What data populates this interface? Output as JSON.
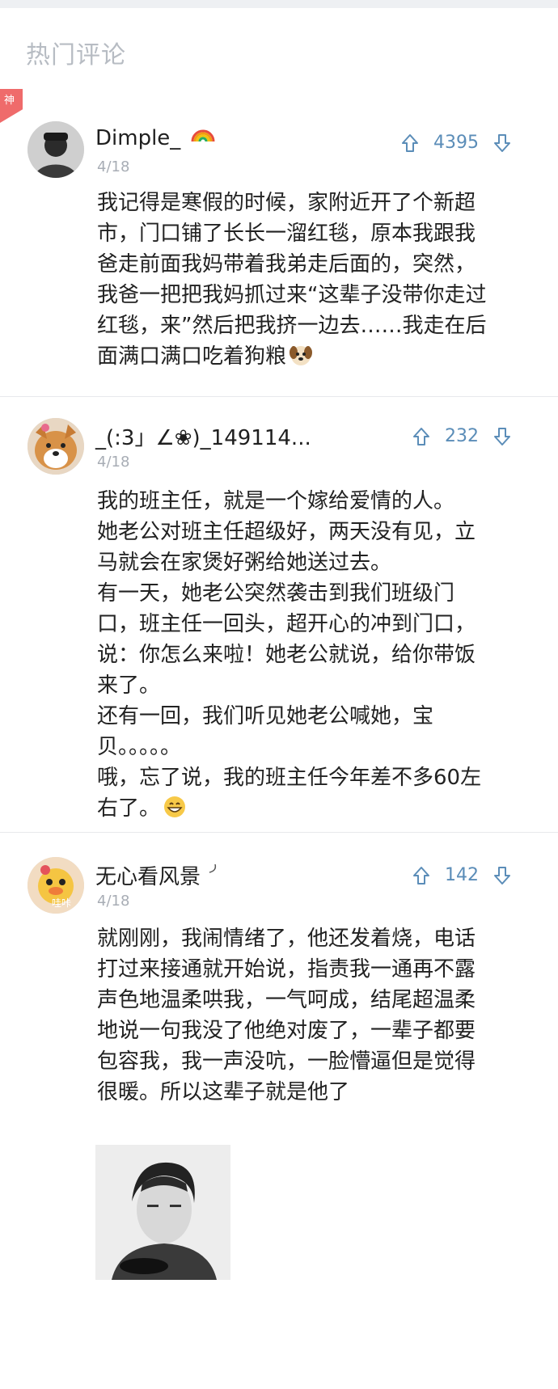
{
  "header": {
    "title": "热门评论"
  },
  "badge": {
    "label": "神"
  },
  "comments": [
    {
      "username": "Dimple_",
      "date": "4/18",
      "likes": "4395",
      "text": "我记得是寒假的时候，家附近开了个新超\n市，门口铺了长长一溜红毯，原本我跟我\n爸走前面我妈带着我弟走后面的，突然，\n我爸一把把我妈抓过来“这辈子没带你走过\n红毯，来”然后把我挤一边去……我走在后\n面满口满口吃着狗粮"
    },
    {
      "username": "_(:3」∠❀)_149114...",
      "date": "4/18",
      "likes": "232",
      "text": "我的班主任，就是一个嫁给爱情的人。\n她老公对班主任超级好，两天没有见，立\n马就会在家煲好粥给她送过去。\n有一天，她老公突然袭击到我们班级门\n口，班主任一回头，超开心的冲到门口，\n说：你怎么来啦！她老公就说，给你带饭\n来了。\n还有一回，我们听见她老公喊她，宝\n贝。。。。。\n哦，忘了说，我的班主任今年差不多60左\n右了。"
    },
    {
      "username": "无心看风景",
      "date": "4/18",
      "likes": "142",
      "text": "就刚刚，我闹情绪了，他还发着烧，电话\n打过来接通就开始说，指责我一通再不露\n声色地温柔哄我，一气呵成，结尾超温柔\n地说一句我没了他绝对废了，一辈子都要\n包容我，我一声没吭，一脸懵逼但是觉得\n很暖。所以这辈子就是他了",
      "avatar_text": "哇咔"
    }
  ],
  "colors": {
    "accent": "#5b8db8",
    "badge": "#ef6b6b",
    "title": "#b7bcc3",
    "date": "#a8adb5"
  },
  "icons": {
    "upvote": "upvote-arrow-icon",
    "downvote": "downvote-arrow-icon"
  }
}
